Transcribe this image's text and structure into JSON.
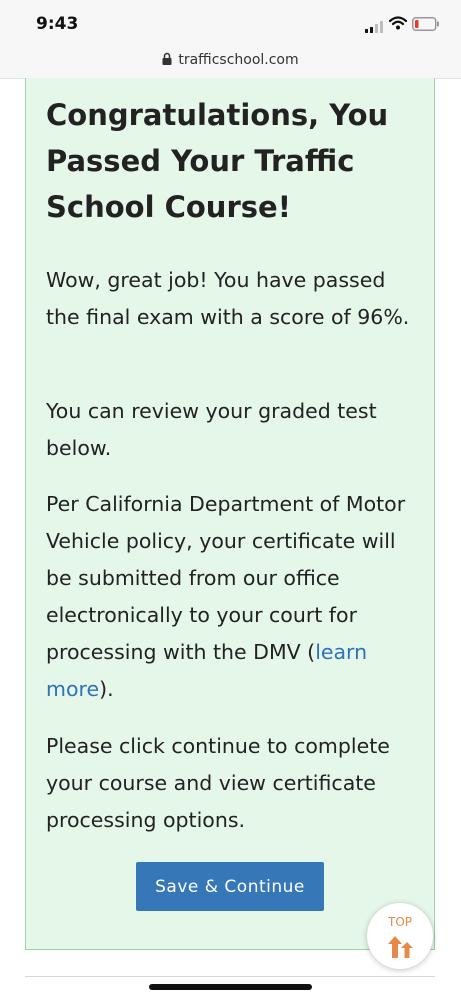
{
  "status_bar": {
    "time": "9:43",
    "signal_icon": "cell-signal-icon",
    "wifi_icon": "wifi-icon",
    "battery_icon": "battery-low-icon"
  },
  "url_bar": {
    "lock_icon": "lock-icon",
    "url": "trafficschool.com"
  },
  "card": {
    "title": "Congratulations, You Passed Your Traffic School Course!",
    "p1": "Wow, great job! You have passed the final exam with a score of 96%.",
    "p2": "You can review your graded test below.",
    "p3_before_link": "Per California Department of Motor Vehicle policy, your certificate will be submitted from our office electronically to your court for processing with the DMV (",
    "p3_link": "learn more",
    "p3_after_link": ").",
    "p4": "Please click continue to complete your course and view certificate processing options.",
    "button_label": "Save & Continue"
  },
  "top_button": {
    "label": "TOP",
    "icon": "arrows-up-icon"
  },
  "colors": {
    "card_bg": "#e5f7e9",
    "card_border": "#9ed2a8",
    "button_bg": "#3677b8",
    "link": "#2e73b8",
    "top_accent": "#e58a4a"
  }
}
